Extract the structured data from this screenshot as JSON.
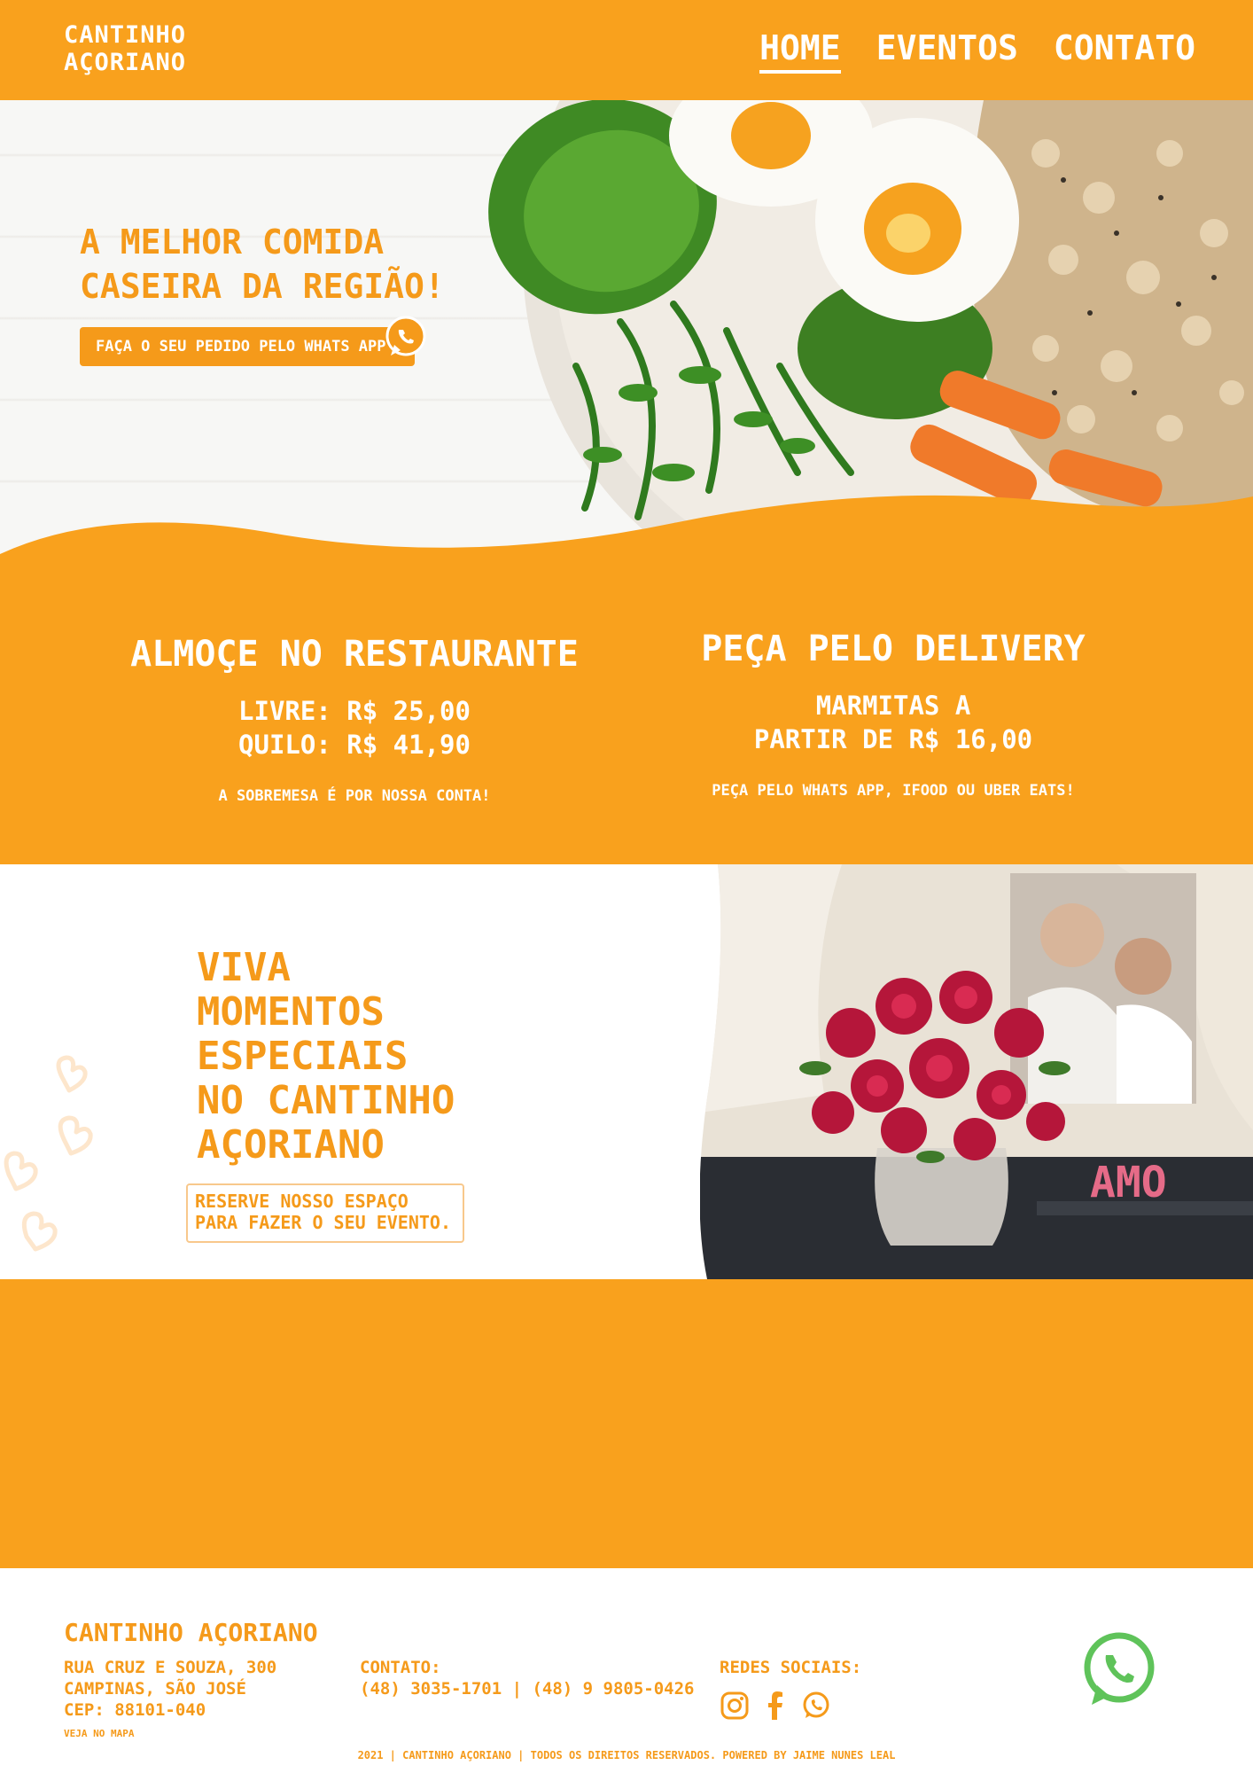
{
  "header": {
    "logo_line1": "CANTINHO",
    "logo_line2": "AÇORIANO",
    "nav": [
      {
        "label": "HOME",
        "active": true
      },
      {
        "label": "EVENTOS",
        "active": false
      },
      {
        "label": "CONTATO",
        "active": false
      }
    ]
  },
  "hero": {
    "title_line1": "A MELHOR COMIDA",
    "title_line2": "CASEIRA DA REGIÃO!",
    "order_button": "FAÇA O SEU PEDIDO PELO WHATS APP",
    "order_icon": "whatsapp-icon"
  },
  "offers": {
    "restaurant": {
      "title": "ALMOÇE NO RESTAURANTE",
      "price_line1": "LIVRE: R$ 25,00",
      "price_line2": "QUILO: R$ 41,90",
      "note": "A SOBREMESA É POR NOSSA CONTA!"
    },
    "delivery": {
      "title": "PEÇA PELO DELIVERY",
      "price_line1": "MARMITAS A",
      "price_line2": "PARTIR DE R$ 16,00",
      "note": "PEÇA PELO WHATS APP, IFOOD OU UBER EATS!"
    }
  },
  "events": {
    "title_line1": "VIVA",
    "title_line2": "MOMENTOS",
    "title_line3": "ESPECIAIS",
    "title_line4": "NO CANTINHO",
    "title_line5": "AÇORIANO",
    "reserve_line1": "RESERVE NOSSO ESPAÇO",
    "reserve_line2": "PARA FAZER O SEU EVENTO.",
    "photo_sign": "AMO"
  },
  "footer": {
    "brand": "CANTINHO AÇORIANO",
    "address_line1": "RUA CRUZ E SOUZA, 300",
    "address_line2": "CAMPINAS, SÃO JOSÉ",
    "address_line3": "CEP: 88101-040",
    "map_link": "VEJA NO MAPA",
    "contact_label": "CONTATO:",
    "contact_phones": "(48) 3035-1701 | (48) 9 9805-0426",
    "social_label": "REDES SOCIAIS:",
    "social_icons": [
      "instagram-icon",
      "facebook-icon",
      "whatsapp-icon"
    ],
    "copyright": "2021 | CANTINHO AÇORIANO | TODOS OS DIREITOS RESERVADOS. POWERED BY JAIME NUNES LEAL"
  },
  "colors": {
    "brand_orange": "#f9a11d",
    "text_orange": "#f59a1a",
    "whatsapp_green": "#5fc35a",
    "white": "#ffffff"
  }
}
